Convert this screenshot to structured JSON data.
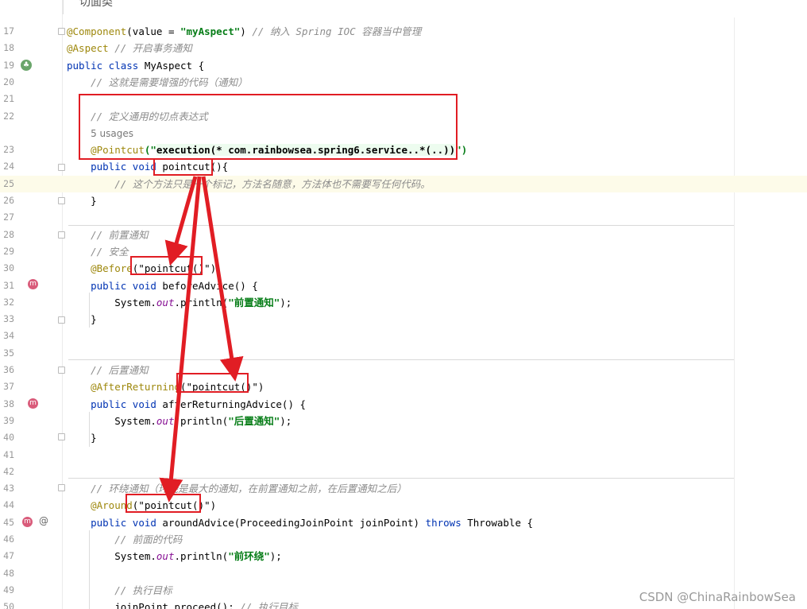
{
  "header": {
    "top_fragment": "切面类"
  },
  "lines": [
    {
      "num": "17",
      "tokens": [
        {
          "t": "@Component",
          "c": "ann"
        },
        {
          "t": "(value = ",
          "c": "plain"
        },
        {
          "t": "\"myAspect\"",
          "c": "str"
        },
        {
          "t": ") ",
          "c": "plain"
        },
        {
          "t": "// 纳入 Spring IOC 容器当中管理",
          "c": "cmt"
        }
      ]
    },
    {
      "num": "18",
      "tokens": [
        {
          "t": "@Aspect",
          "c": "ann"
        },
        {
          "t": " ",
          "c": "plain"
        },
        {
          "t": "// 开启事务通知",
          "c": "cmt"
        }
      ]
    },
    {
      "num": "19",
      "tokens": [
        {
          "t": "public class ",
          "c": "kw"
        },
        {
          "t": "MyAspect {",
          "c": "plain"
        }
      ]
    },
    {
      "num": "20",
      "tokens": [
        {
          "t": "    ",
          "c": "plain"
        },
        {
          "t": "// 这就是需要增强的代码（通知）",
          "c": "cmt"
        }
      ]
    },
    {
      "num": "21",
      "tokens": []
    },
    {
      "num": "22",
      "tokens": [
        {
          "t": "    ",
          "c": "plain"
        },
        {
          "t": "// 定义通用的切点表达式",
          "c": "cmt"
        }
      ]
    },
    {
      "num": "",
      "tokens": [
        {
          "t": "    ",
          "c": "plain"
        },
        {
          "t": "5 usages",
          "c": "hint"
        }
      ]
    },
    {
      "num": "23",
      "tokens": [
        {
          "t": "    ",
          "c": "plain"
        },
        {
          "t": "@Pointcut",
          "c": "ann"
        },
        {
          "t": "(\"",
          "c": "str"
        },
        {
          "t": "execution(* com.rainbowsea.spring6.service..*(..))",
          "c": "exec"
        },
        {
          "t": "\")",
          "c": "str"
        }
      ]
    },
    {
      "num": "24",
      "tokens": [
        {
          "t": "    ",
          "c": "plain"
        },
        {
          "t": "public void ",
          "c": "kw"
        },
        {
          "t": "pointcut(){",
          "c": "plain"
        }
      ]
    },
    {
      "num": "25",
      "tokens": [
        {
          "t": "        ",
          "c": "plain"
        },
        {
          "t": "// 这个方法只是一个标记，方法名随意，方法体也不需要写任何代码。",
          "c": "cmt"
        }
      ],
      "hl": true
    },
    {
      "num": "26",
      "tokens": [
        {
          "t": "    }",
          "c": "plain"
        }
      ]
    },
    {
      "num": "27",
      "tokens": []
    },
    {
      "num": "28",
      "tokens": [
        {
          "t": "    ",
          "c": "plain"
        },
        {
          "t": "// 前置通知",
          "c": "cmt"
        }
      ]
    },
    {
      "num": "29",
      "tokens": [
        {
          "t": "    ",
          "c": "plain"
        },
        {
          "t": "// 安全",
          "c": "cmt"
        }
      ]
    },
    {
      "num": "30",
      "tokens": [
        {
          "t": "    ",
          "c": "plain"
        },
        {
          "t": "@Before",
          "c": "ann"
        },
        {
          "t": "(",
          "c": "plain"
        },
        {
          "t": "\"pointcut()\"",
          "c": "plain"
        },
        {
          "t": ")",
          "c": "plain"
        }
      ]
    },
    {
      "num": "31",
      "tokens": [
        {
          "t": "    ",
          "c": "plain"
        },
        {
          "t": "public void ",
          "c": "kw"
        },
        {
          "t": "beforeAdvice() {",
          "c": "plain"
        }
      ]
    },
    {
      "num": "32",
      "tokens": [
        {
          "t": "        System.",
          "c": "plain"
        },
        {
          "t": "out",
          "c": "fld"
        },
        {
          "t": ".println(",
          "c": "plain"
        },
        {
          "t": "\"前置通知\"",
          "c": "str"
        },
        {
          "t": ");",
          "c": "plain"
        }
      ]
    },
    {
      "num": "33",
      "tokens": [
        {
          "t": "    }",
          "c": "plain"
        }
      ]
    },
    {
      "num": "34",
      "tokens": []
    },
    {
      "num": "35",
      "tokens": []
    },
    {
      "num": "36",
      "tokens": [
        {
          "t": "    ",
          "c": "plain"
        },
        {
          "t": "// 后置通知",
          "c": "cmt"
        }
      ]
    },
    {
      "num": "37",
      "tokens": [
        {
          "t": "    ",
          "c": "plain"
        },
        {
          "t": "@AfterReturning",
          "c": "ann"
        },
        {
          "t": "(",
          "c": "plain"
        },
        {
          "t": "\"pointcut()\"",
          "c": "plain"
        },
        {
          "t": ")",
          "c": "plain"
        }
      ]
    },
    {
      "num": "38",
      "tokens": [
        {
          "t": "    ",
          "c": "plain"
        },
        {
          "t": "public void ",
          "c": "kw"
        },
        {
          "t": "afterReturningAdvice() {",
          "c": "plain"
        }
      ]
    },
    {
      "num": "39",
      "tokens": [
        {
          "t": "        System.",
          "c": "plain"
        },
        {
          "t": "out",
          "c": "fld"
        },
        {
          "t": ".println(",
          "c": "plain"
        },
        {
          "t": "\"后置通知\"",
          "c": "str"
        },
        {
          "t": ");",
          "c": "plain"
        }
      ]
    },
    {
      "num": "40",
      "tokens": [
        {
          "t": "    }",
          "c": "plain"
        }
      ]
    },
    {
      "num": "41",
      "tokens": []
    },
    {
      "num": "42",
      "tokens": []
    },
    {
      "num": "43",
      "tokens": [
        {
          "t": "    ",
          "c": "plain"
        },
        {
          "t": "// 环绕通知（环绕是最大的通知，在前置通知之前，在后置通知之后）",
          "c": "cmt"
        }
      ]
    },
    {
      "num": "44",
      "tokens": [
        {
          "t": "    ",
          "c": "plain"
        },
        {
          "t": "@Around",
          "c": "ann"
        },
        {
          "t": "(",
          "c": "plain"
        },
        {
          "t": "\"pointcut()\"",
          "c": "plain"
        },
        {
          "t": ")",
          "c": "plain"
        }
      ]
    },
    {
      "num": "45",
      "tokens": [
        {
          "t": "    ",
          "c": "plain"
        },
        {
          "t": "public void ",
          "c": "kw"
        },
        {
          "t": "aroundAdvice(ProceedingJoinPoint joinPoint) ",
          "c": "plain"
        },
        {
          "t": "throws ",
          "c": "kw"
        },
        {
          "t": "Throwable {",
          "c": "plain"
        }
      ]
    },
    {
      "num": "46",
      "tokens": [
        {
          "t": "        ",
          "c": "plain"
        },
        {
          "t": "// 前面的代码",
          "c": "cmt"
        }
      ]
    },
    {
      "num": "47",
      "tokens": [
        {
          "t": "        System.",
          "c": "plain"
        },
        {
          "t": "out",
          "c": "fld"
        },
        {
          "t": ".println(",
          "c": "plain"
        },
        {
          "t": "\"前环绕\"",
          "c": "str"
        },
        {
          "t": ");",
          "c": "plain"
        }
      ]
    },
    {
      "num": "48",
      "tokens": []
    },
    {
      "num": "49",
      "tokens": [
        {
          "t": "        ",
          "c": "plain"
        },
        {
          "t": "// 执行目标",
          "c": "cmt"
        }
      ]
    },
    {
      "num": "50",
      "tokens": [
        {
          "t": "        joinPoint.proceed(); ",
          "c": "plain"
        },
        {
          "t": "// 执行目标",
          "c": "cmt"
        }
      ]
    }
  ],
  "watermark": "CSDN @ChinaRainbowSea",
  "gutter_icons": [
    {
      "line": "19",
      "icon": "spring-bean-icon",
      "glyph": "♣"
    },
    {
      "line": "31",
      "icon": "advice-method-icon",
      "glyph": "m"
    },
    {
      "line": "38",
      "icon": "advice-method-icon",
      "glyph": "m"
    },
    {
      "line": "45",
      "icon": "advice-method-icon",
      "glyph": "m"
    },
    {
      "line": "45",
      "icon": "at-annotation-icon",
      "glyph": "@"
    }
  ],
  "colors": {
    "annotation": "#9e880d",
    "keyword": "#0033b3",
    "string": "#067d17",
    "comment": "#8c8c8c",
    "highlight": "#fdfbe9",
    "red_markup": "#e11d24"
  }
}
